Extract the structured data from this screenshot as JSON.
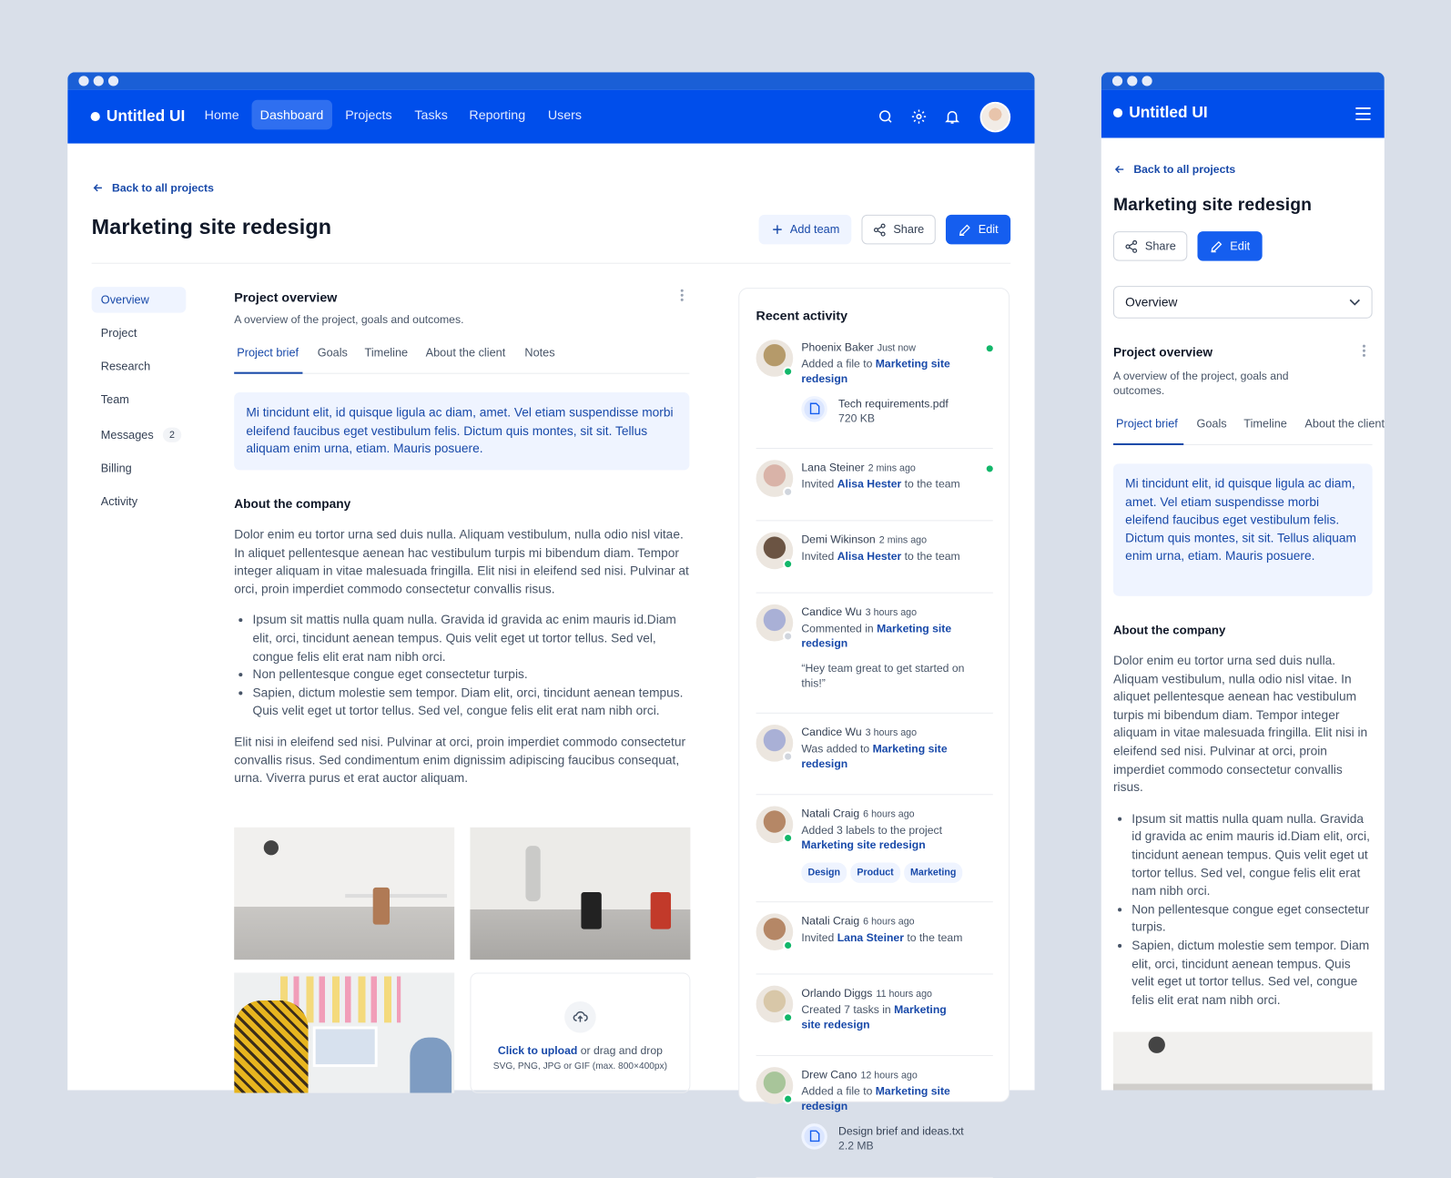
{
  "app": {
    "name": "Untitled UI"
  },
  "nav": {
    "items": [
      "Home",
      "Dashboard",
      "Projects",
      "Tasks",
      "Reporting",
      "Users"
    ],
    "active": "Dashboard"
  },
  "page": {
    "back": "Back to all projects",
    "title": "Marketing site redesign",
    "add_team": "Add team",
    "share": "Share",
    "edit": "Edit"
  },
  "sidebar": {
    "items": [
      {
        "label": "Overview"
      },
      {
        "label": "Project"
      },
      {
        "label": "Research"
      },
      {
        "label": "Team"
      },
      {
        "label": "Messages",
        "badge": "2"
      },
      {
        "label": "Billing"
      },
      {
        "label": "Activity"
      }
    ]
  },
  "overview": {
    "title": "Project overview",
    "subtitle": "A overview of the project, goals and outcomes.",
    "tabs": [
      "Project brief",
      "Goals",
      "Timeline",
      "About the client",
      "Notes"
    ],
    "brief": "Mi tincidunt elit, id quisque ligula ac diam, amet. Vel etiam suspendisse morbi eleifend faucibus eget vestibulum felis. Dictum quis montes, sit sit. Tellus aliquam enim urna, etiam. Mauris posuere.",
    "about_title": "About the company",
    "about_p1": "Dolor enim eu tortor urna sed duis nulla. Aliquam vestibulum, nulla odio nisl vitae. In aliquet pellentesque aenean hac vestibulum turpis mi bibendum diam. Tempor integer aliquam in vitae malesuada fringilla. Elit nisi in eleifend sed nisi. Pulvinar at orci, proin imperdiet commodo consectetur convallis risus.",
    "bullets": [
      "Ipsum sit mattis nulla quam nulla. Gravida id gravida ac enim mauris id.Diam elit, orci, tincidunt aenean tempus. Quis velit eget ut tortor tellus. Sed vel, congue felis elit erat nam nibh orci.",
      "Non pellentesque congue eget consectetur turpis.",
      "Sapien, dictum molestie sem tempor. Diam elit, orci, tincidunt aenean tempus. Quis velit eget ut tortor tellus. Sed vel, congue felis elit erat nam nibh orci."
    ],
    "about_p2": "Elit nisi in eleifend sed nisi. Pulvinar at orci, proin imperdiet commodo consectetur convallis risus. Sed condimentum enim dignissim adipiscing faucibus consequat, urna. Viverra purus et erat auctor aliquam.",
    "upload_link": "Click to upload",
    "upload_rest": " or drag and drop",
    "upload_hint": "SVG, PNG, JPG or GIF (max. 800×400px)"
  },
  "activity": {
    "title": "Recent activity",
    "items": [
      {
        "name": "Phoenix Baker",
        "time": "Just now",
        "pre": "Added a file to ",
        "link": "Marketing site redesign",
        "post": "",
        "online": true,
        "unread": true,
        "file": {
          "name": "Tech requirements.pdf",
          "size": "720 KB"
        },
        "av": "#b59a6a"
      },
      {
        "name": "Lana Steiner",
        "time": "2 mins ago",
        "pre": "Invited ",
        "link": "Alisa Hester",
        "post": " to the team",
        "online": false,
        "unread": true,
        "av": "#d9b3a8"
      },
      {
        "name": "Demi Wikinson",
        "time": "2 mins ago",
        "pre": "Invited ",
        "link": "Alisa Hester",
        "post": " to the team",
        "online": true,
        "av": "#6b5443"
      },
      {
        "name": "Candice Wu",
        "time": "3 hours ago",
        "pre": "Commented in ",
        "link": "Marketing site redesign",
        "post": "",
        "online": false,
        "quote": "“Hey team great to get started on this!”",
        "av": "#a9b0d6"
      },
      {
        "name": "Candice Wu",
        "time": "3 hours ago",
        "pre": "Was added to ",
        "link": "Marketing site redesign",
        "post": "",
        "online": false,
        "av": "#a9b0d6"
      },
      {
        "name": "Natali Craig",
        "time": "6 hours ago",
        "pre": "Added 3 labels to the project ",
        "link": "Marketing site redesign",
        "post": "",
        "online": true,
        "tags": [
          "Design",
          "Product",
          "Marketing"
        ],
        "av": "#b58766"
      },
      {
        "name": "Natali Craig",
        "time": "6 hours ago",
        "pre": "Invited ",
        "link": "Lana Steiner",
        "post": " to the team",
        "online": true,
        "av": "#b58766"
      },
      {
        "name": "Orlando Diggs",
        "time": "11 hours ago",
        "pre": "Created 7 tasks in ",
        "link": "Marketing site redesign",
        "post": "",
        "online": true,
        "av": "#d8c7a8"
      },
      {
        "name": "Drew Cano",
        "time": "12 hours ago",
        "pre": "Added a file to ",
        "link": "Marketing site redesign",
        "post": "",
        "online": true,
        "file": {
          "name": "Design brief and ideas.txt",
          "size": "2.2 MB"
        },
        "av": "#a8c59a"
      }
    ]
  },
  "mobile": {
    "select_value": "Overview",
    "tabs": [
      "Project brief",
      "Goals",
      "Timeline",
      "About the client"
    ]
  },
  "colors": {
    "brand": "#004EEB",
    "accent": "#155EEF",
    "online": "#12B76A",
    "background": "#D9DFE9"
  }
}
